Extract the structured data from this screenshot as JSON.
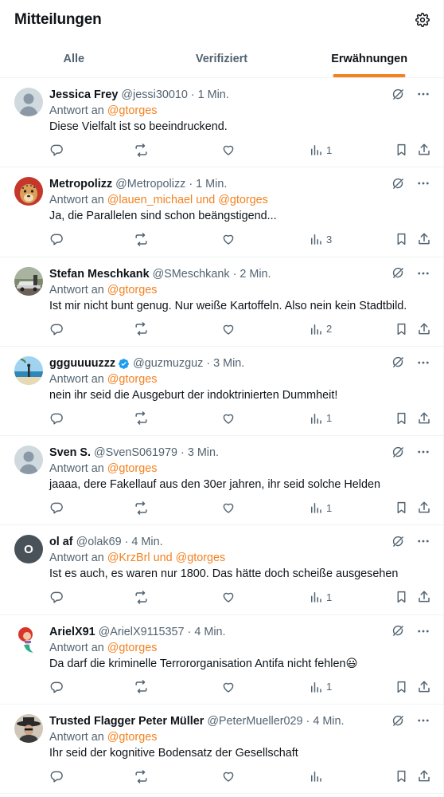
{
  "header": {
    "title": "Mitteilungen",
    "settings_icon": "gear-icon"
  },
  "tabs": [
    {
      "label": "Alle",
      "active": false
    },
    {
      "label": "Verifiziert",
      "active": false
    },
    {
      "label": "Erwähnungen",
      "active": true
    }
  ],
  "colors": {
    "accent": "#f4811f",
    "secondary_text": "#536471",
    "primary_text": "#0f1419"
  },
  "reply_prefix": "Antwort an",
  "tweets": [
    {
      "name": "Jessica Frey",
      "handle": "@jessi30010 · 1 Min.",
      "reply_to": "@gtorges",
      "text": "Diese Vielfalt ist so beeindruckend.",
      "views": "1",
      "avatar": "default"
    },
    {
      "name": "Metropolizz",
      "handle": "@Metropolizz · 1 Min.",
      "reply_to": "@lauen_michael und @gtorges",
      "text": "Ja, die Parallelen sind schon beängstigend...",
      "views": "3",
      "avatar": "cheetah"
    },
    {
      "name": "Stefan Meschkank",
      "handle": "@SMeschkank · 2 Min.",
      "reply_to": "@gtorges",
      "text": "Ist mir nicht bunt genug. Nur weiße Kartoffeln. Also nein kein Stadtbild.",
      "views": "2",
      "avatar": "car"
    },
    {
      "name": "ggguuuuzzz",
      "handle": "@guzmuzguz · 3 Min.",
      "reply_to": "@gtorges",
      "text": "nein ihr seid die Ausgeburt der indoktrinierten Dummheit!",
      "views": "1",
      "avatar": "beach",
      "verified": true
    },
    {
      "name": "Sven S.",
      "handle": "@SvenS061979 · 3 Min.",
      "reply_to": "@gtorges",
      "text": "jaaaa, dere Fakellauf aus den 30er jahren, ihr seid solche Helden",
      "views": "1",
      "avatar": "default"
    },
    {
      "name": "ol af",
      "handle": "@olak69 · 4 Min.",
      "reply_to": "@KrzBrl und @gtorges",
      "text": "Ist es auch, es waren nur 1800. Das hätte doch scheiße ausgesehen",
      "views": "1",
      "avatar": "letter",
      "avatar_letter": "O"
    },
    {
      "name": "ArielX91",
      "handle": "@ArielX9115357 · 4 Min.",
      "reply_to": "@gtorges",
      "text": "Da darf die kriminelle Terrororganisation Antifa nicht fehlen😃",
      "views": "1",
      "avatar": "mermaid"
    },
    {
      "name": "Trusted Flagger Peter Müller",
      "handle": "@PeterMueller029 · 4 Min.",
      "reply_to": "@gtorges",
      "text": "Ihr seid der kognitive Bodensatz der Gesellschaft",
      "views": "",
      "avatar": "hat"
    }
  ]
}
